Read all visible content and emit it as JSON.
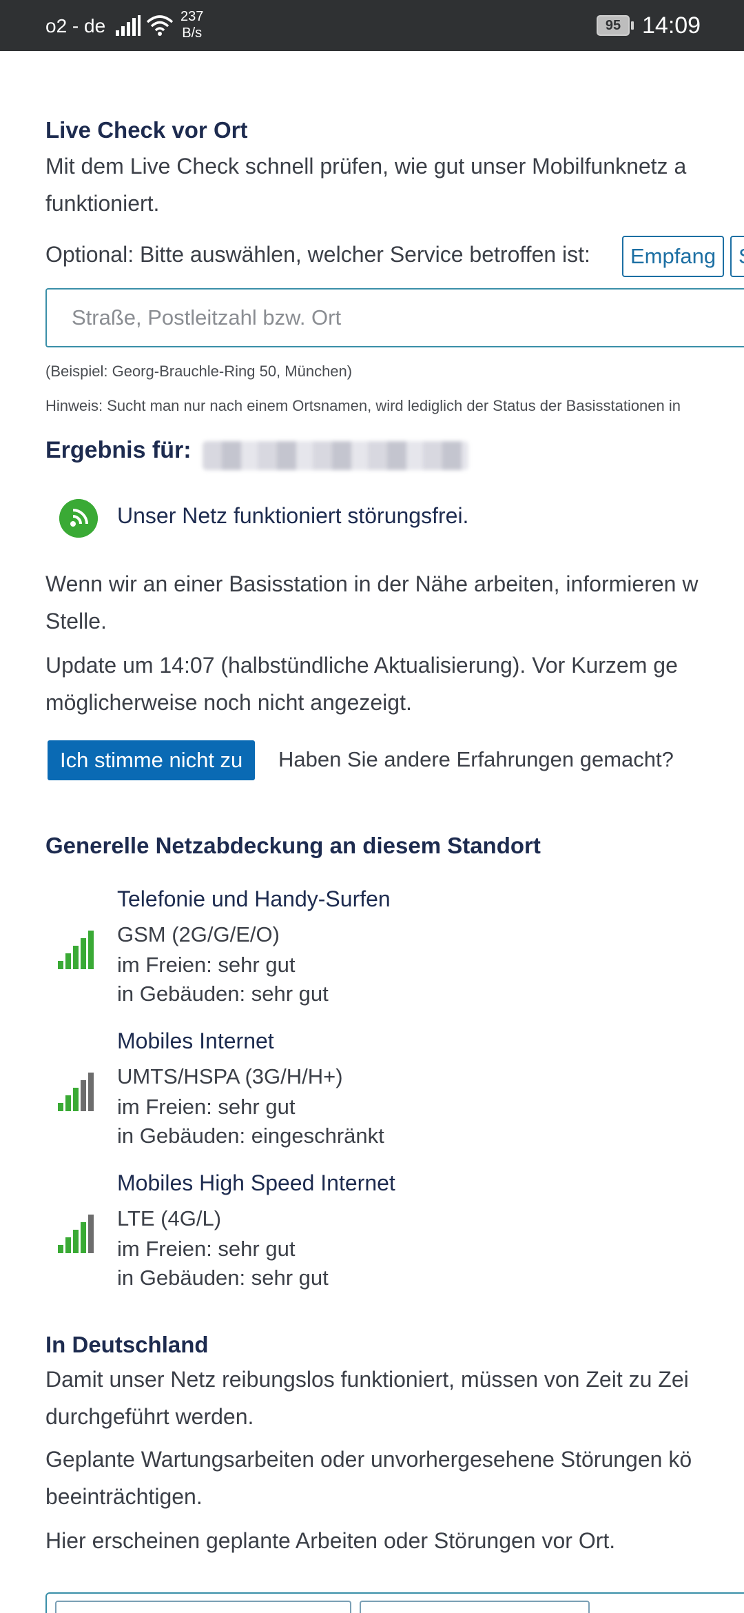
{
  "status_bar": {
    "carrier": "o2 - de",
    "speed_value": "237",
    "speed_unit": "B/s",
    "battery": "95",
    "time": "14:09"
  },
  "live_check": {
    "heading": "Live Check vor Ort",
    "intro_line1": "Mit dem Live Check schnell prüfen, wie gut unser Mobilfunknetz a",
    "intro_line2": "funktioniert.",
    "service_prompt": "Optional: Bitte auswählen, welcher Service betroffen ist:",
    "service_buttons": [
      "Empfang",
      "S"
    ],
    "search_placeholder": "Straße, Postleitzahl bzw. Ort",
    "example": "(Beispiel: Georg-Brauchle-Ring 50, München)",
    "hint": "Hinweis: Sucht man nur nach einem Ortsnamen, wird lediglich der Status der Basisstationen in"
  },
  "result": {
    "title": "Ergebnis für:",
    "status": "Unser Netz funktioniert störungsfrei.",
    "info_line1": "Wenn wir an einer Basisstation in der Nähe arbeiten, informieren w",
    "info_line2": "Stelle.",
    "update_line1": "Update um 14:07 (halbstündliche Aktualisierung). Vor Kurzem ge",
    "update_line2": "möglicherweise noch nicht angezeigt.",
    "disagree_button": "Ich stimme nicht zu",
    "disagree_note": "Haben Sie andere Erfahrungen gemacht?"
  },
  "coverage": {
    "heading": "Generelle Netzabdeckung an diesem Standort",
    "items": [
      {
        "title": "Telefonie und Handy-Surfen",
        "tech": "GSM (2G/G/E/O)",
        "outdoor": "im Freien: sehr gut",
        "indoor": "in Gebäuden: sehr gut",
        "level": 5
      },
      {
        "title": "Mobiles Internet",
        "tech": "UMTS/HSPA (3G/H/H+)",
        "outdoor": "im Freien: sehr gut",
        "indoor": "in Gebäuden: eingeschränkt",
        "level": 3
      },
      {
        "title": "Mobiles High Speed Internet",
        "tech": "LTE (4G/L)",
        "outdoor": "im Freien: sehr gut",
        "indoor": "in Gebäuden: sehr gut",
        "level": 4
      }
    ]
  },
  "germany": {
    "heading": "In Deutschland",
    "p1_line1": "Damit unser Netz reibungslos funktioniert, müssen von Zeit zu Zei",
    "p1_line2": "durchgeführt werden.",
    "p2_line1": "Geplante Wartungsarbeiten oder unvorhergesehene Störungen kö",
    "p2_line2": "beeinträchtigen.",
    "p3": "Hier erscheinen geplante Arbeiten oder Störungen vor Ort."
  },
  "colors": {
    "heading": "#1d2b4f",
    "accent": "#1c6fa3",
    "button": "#0a6ab4",
    "signal_green": "#3aaa35",
    "signal_gray": "#6d6d6d"
  }
}
